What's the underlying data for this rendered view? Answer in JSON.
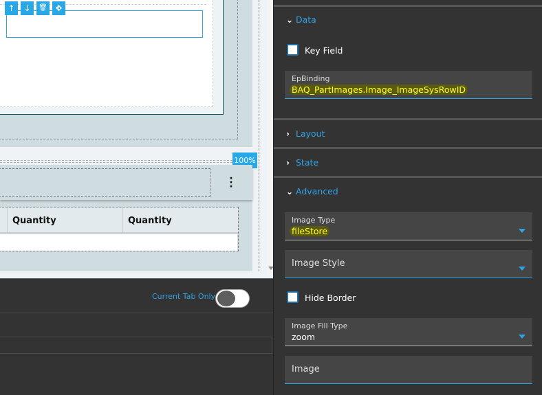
{
  "canvas": {
    "toolbar": [
      {
        "icon": "arrow-up-icon",
        "glyph": "↑"
      },
      {
        "icon": "arrow-down-icon",
        "glyph": "↓"
      },
      {
        "icon": "trash-icon",
        "glyph": "🗑"
      },
      {
        "icon": "move-icon",
        "glyph": "✥"
      }
    ],
    "zoom_badge": "100%",
    "grid_headers": [
      "Quantity",
      "Quantity"
    ]
  },
  "bottom": {
    "toggle_label": "Current Tab Only",
    "toggle_on": false
  },
  "panel": {
    "sections": {
      "data": "Data",
      "layout": "Layout",
      "state": "State",
      "advanced": "Advanced"
    },
    "key_field": "Key Field",
    "ep_binding": {
      "label": "EpBinding",
      "value": "BAQ_PartImages.Image_ImageSysRowID"
    },
    "image_type": {
      "label": "Image Type",
      "value": "fileStore"
    },
    "image_style": {
      "label": "Image Style"
    },
    "hide_border": "Hide Border",
    "image_fill_type": {
      "label": "Image Fill Type",
      "value": "zoom"
    },
    "image": {
      "label": "Image"
    }
  },
  "colors": {
    "accent": "#29a8e8",
    "panel_bg": "#333333",
    "highlight": "#ffff2a"
  }
}
